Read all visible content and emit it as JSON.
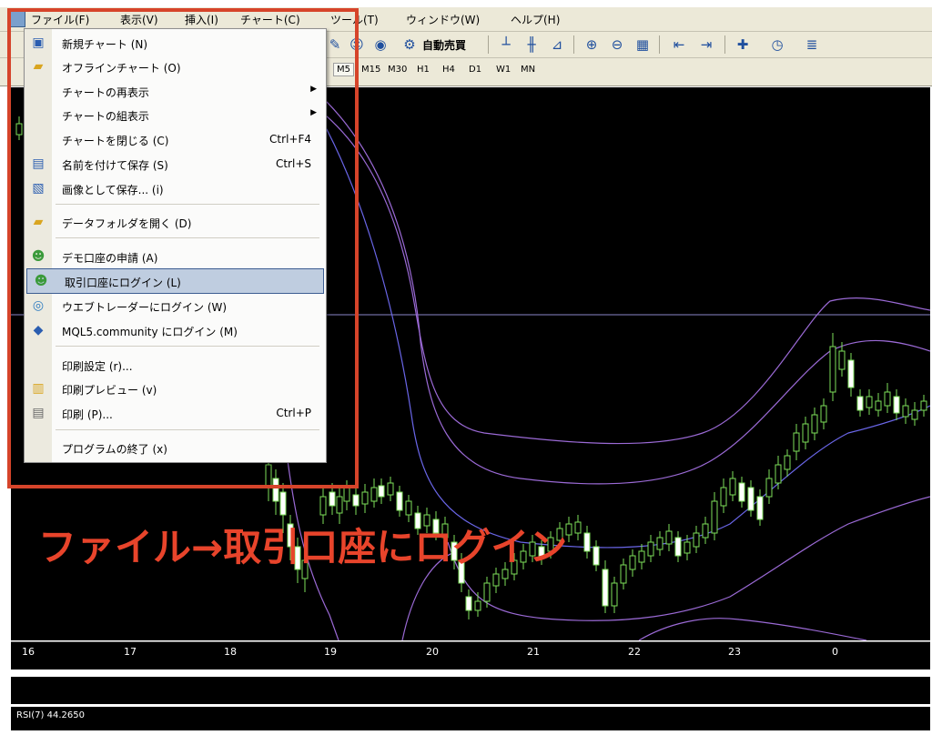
{
  "menubar": {
    "items": [
      "ファイル(F)",
      "表示(V)",
      "挿入(I)",
      "チャート(C)",
      "ツール(T)",
      "ウィンドウ(W)",
      "ヘルプ(H)"
    ]
  },
  "toolbar": {
    "auto_trade_label": "自動売買"
  },
  "timeframes": [
    "M5",
    "M15",
    "M30",
    "H1",
    "H4",
    "D1",
    "W1",
    "MN"
  ],
  "file_menu": {
    "items": [
      {
        "label": "新規チャート (N)",
        "shortcut": "",
        "icon": "new-chart-icon"
      },
      {
        "label": "オフラインチャート (O)",
        "shortcut": "",
        "icon": "folder-open-icon"
      },
      {
        "label": "チャートの再表示",
        "shortcut": "",
        "icon": ""
      },
      {
        "label": "チャートの組表示",
        "shortcut": "",
        "icon": ""
      },
      {
        "label": "チャートを閉じる (C)",
        "shortcut": "Ctrl+F4",
        "icon": ""
      },
      {
        "label": "名前を付けて保存 (S)",
        "shortcut": "Ctrl+S",
        "icon": "save-icon"
      },
      {
        "label": "画像として保存... (i)",
        "shortcut": "",
        "icon": "save-image-icon"
      },
      {
        "label": "データフォルダを開く (D)",
        "shortcut": "",
        "icon": "folder-icon"
      },
      {
        "label": "デモ口座の申請 (A)",
        "shortcut": "",
        "icon": "user-add-icon"
      },
      {
        "label": "取引口座にログイン (L)",
        "shortcut": "",
        "icon": "user-login-icon"
      },
      {
        "label": "ウエブトレーダーにログイン (W)",
        "shortcut": "",
        "icon": "globe-icon"
      },
      {
        "label": "MQL5.community にログイン (M)",
        "shortcut": "",
        "icon": "mql5-icon"
      },
      {
        "label": "印刷設定 (r)...",
        "shortcut": "",
        "icon": ""
      },
      {
        "label": "印刷プレビュー (v)",
        "shortcut": "",
        "icon": "print-preview-icon"
      },
      {
        "label": "印刷 (P)...",
        "shortcut": "Ctrl+P",
        "icon": "printer-icon"
      },
      {
        "label": "プログラムの終了 (x)",
        "shortcut": "",
        "icon": ""
      }
    ]
  },
  "date_axis": [
    "16",
    "17",
    "18",
    "19",
    "20",
    "21",
    "22",
    "23",
    "0"
  ],
  "rsi": {
    "label": "RSI(7) 44.2650"
  },
  "caption": "ファイル→取引口座にログイン",
  "colors": {
    "accent_red": "#d6442a",
    "highlight": "#bfcde0",
    "bull_candle": "#7ee05a",
    "bear_candle": "#ffffff",
    "band_line": "#9b6ad6"
  }
}
